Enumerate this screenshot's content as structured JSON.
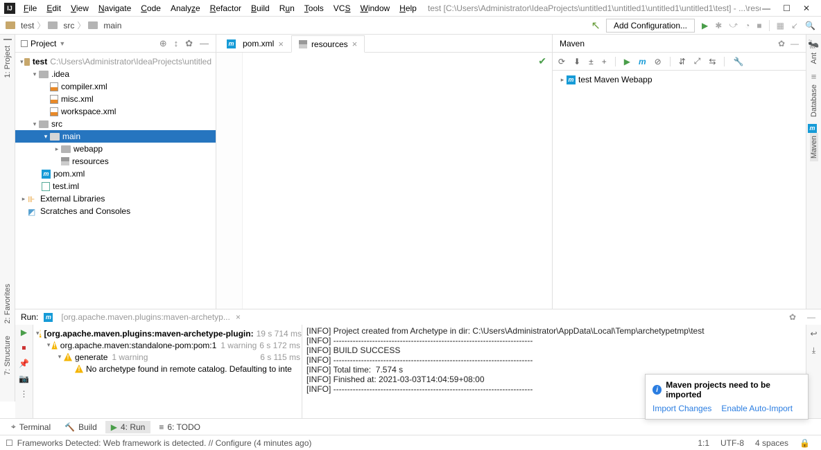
{
  "menu": {
    "items": [
      "File",
      "Edit",
      "View",
      "Navigate",
      "Code",
      "Analyze",
      "Refactor",
      "Build",
      "Run",
      "Tools",
      "VCS",
      "Window",
      "Help"
    ]
  },
  "title_path": "test [C:\\Users\\Administrator\\IdeaProjects\\untitled1\\untitled1\\untitled1\\untitled1\\test] - ...\\resources",
  "breadcrumb": {
    "items": [
      "test",
      "src",
      "main"
    ]
  },
  "add_config": "Add Configuration...",
  "left_gutter": {
    "project": "1: Project"
  },
  "project_panel": {
    "title": "Project",
    "root": {
      "name": "test",
      "path": "C:\\Users\\Administrator\\IdeaProjects\\untitled"
    },
    "idea": {
      "name": ".idea",
      "children": [
        "compiler.xml",
        "misc.xml",
        "workspace.xml"
      ]
    },
    "src": {
      "name": "src",
      "main": "main",
      "webapp": "webapp",
      "resources": "resources"
    },
    "pom": "pom.xml",
    "iml": "test.iml",
    "ext": "External Libraries",
    "scratches": "Scratches and Consoles"
  },
  "tabs": {
    "pom": "pom.xml",
    "resources": "resources"
  },
  "maven": {
    "title": "Maven",
    "project": "test Maven Webapp"
  },
  "right_gutter": {
    "ant": "Ant",
    "db": "Database",
    "mvn": "Maven"
  },
  "run": {
    "label": "Run:",
    "config": "[org.apache.maven.plugins:maven-archetyp...",
    "rows": [
      {
        "lvl": 0,
        "bold": true,
        "name": "[org.apache.maven.plugins:maven-archetype-plugin:",
        "meta": "19 s 714 ms"
      },
      {
        "lvl": 1,
        "bold": false,
        "name": "org.apache.maven:standalone-pom:pom:1",
        "warn": "1 warning",
        "meta": "6 s 172 ms"
      },
      {
        "lvl": 2,
        "bold": false,
        "name": "generate",
        "warn": "1 warning",
        "meta": "6 s 115 ms"
      },
      {
        "lvl": 3,
        "bold": false,
        "name": "No archetype found in remote catalog. Defaulting to inte"
      }
    ],
    "console": [
      "[INFO] Project created from Archetype in dir: C:\\Users\\Administrator\\AppData\\Local\\Temp\\archetypetmp\\test",
      "[INFO] ------------------------------------------------------------------------",
      "[INFO] BUILD SUCCESS",
      "[INFO] ------------------------------------------------------------------------",
      "[INFO] Total time:  7.574 s",
      "[INFO] Finished at: 2021-03-03T14:04:59+08:00",
      "[INFO] ------------------------------------------------------------------------"
    ]
  },
  "notification": {
    "title": "Maven projects need to be imported",
    "import": "Import Changes",
    "auto": "Enable Auto-Import"
  },
  "bottom_tabs": {
    "terminal": "Terminal",
    "build": "Build",
    "run": "4: Run",
    "todo": "6: TODO"
  },
  "status": {
    "msg": "Frameworks Detected: Web framework is detected. // Configure (4 minutes ago)",
    "pos": "1:1",
    "enc": "UTF-8",
    "spaces": "4 spaces"
  },
  "left_tools": {
    "fav": "2: Favorites",
    "struct": "7: Structure"
  }
}
